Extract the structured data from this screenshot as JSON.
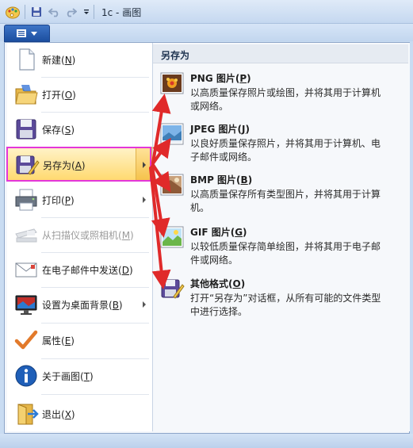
{
  "window": {
    "title": "1c - 画图"
  },
  "menu_left": [
    {
      "label": "新建(",
      "key": "N",
      "end": ")",
      "icon": "new-file-icon"
    },
    {
      "label": "打开(",
      "key": "O",
      "end": ")",
      "icon": "open-folder-icon"
    },
    {
      "label": "保存(",
      "key": "S",
      "end": ")",
      "icon": "save-disk-icon"
    },
    {
      "label": "另存为(",
      "key": "A",
      "end": ")",
      "icon": "save-as-icon",
      "submenu": true,
      "highlighted": true
    },
    {
      "label": "打印(",
      "key": "P",
      "end": ")",
      "icon": "printer-icon",
      "submenu": true
    },
    {
      "label": "从扫描仪或照相机(",
      "key": "M",
      "end": ")",
      "icon": "scanner-icon",
      "disabled": true
    },
    {
      "label": "在电子邮件中发送(",
      "key": "D",
      "end": ")",
      "icon": "email-icon"
    },
    {
      "label": "设置为桌面背景(",
      "key": "B",
      "end": ")",
      "icon": "desktop-background-icon",
      "submenu": true
    },
    {
      "label": "属性(",
      "key": "E",
      "end": ")",
      "icon": "checkmark-icon"
    },
    {
      "label": "关于画图(",
      "key": "T",
      "end": ")",
      "icon": "info-icon"
    },
    {
      "label": "退出(",
      "key": "X",
      "end": ")",
      "icon": "exit-icon"
    }
  ],
  "submenu": {
    "header": "另存为",
    "options": [
      {
        "title": "PNG 图片(",
        "key": "P",
        "end": ")",
        "desc": "以高质量保存照片或绘图，并将其用于计算机或网络。",
        "icon": "png-picture-icon"
      },
      {
        "title": "JPEG 图片(",
        "key": "J",
        "end": ")",
        "desc": "以良好质量保存照片，并将其用于计算机、电子邮件或网络。",
        "icon": "jpeg-picture-icon"
      },
      {
        "title": "BMP 图片(",
        "key": "B",
        "end": ")",
        "desc": "以高质量保存所有类型图片，并将其用于计算机。",
        "icon": "bmp-picture-icon"
      },
      {
        "title": "GIF 图片(",
        "key": "G",
        "end": ")",
        "desc": "以较低质量保存简单绘图，并将其用于电子邮件或网络。",
        "icon": "gif-picture-icon"
      },
      {
        "title": "其他格式(",
        "key": "O",
        "end": ")",
        "desc": "打开“另存为”对话框，从所有可能的文件类型中进行选择。",
        "icon": "other-formats-icon"
      }
    ]
  },
  "colors": {
    "highlight_border": "#e436d9",
    "annotation_arrow": "#e02a2a",
    "selected_item": "#ffd96e"
  }
}
